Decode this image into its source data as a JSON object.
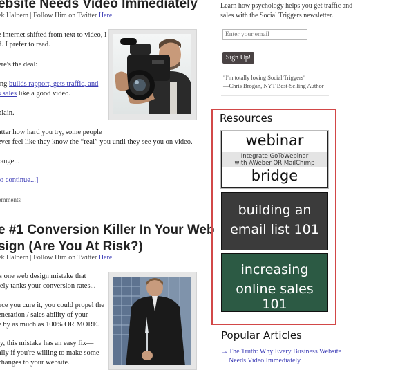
{
  "post1": {
    "title": "ebsite Needs Video Immediately",
    "meta_author": "ek Halpern | Follow Him on Twitter ",
    "meta_link": "Here",
    "p1_l1": "e internet shifted from text to video, I",
    "p1_l2": "d. I prefer to read.",
    "p2": "ere's the deal:",
    "p3_pre": "ing ",
    "p3_link1": "builds rapport, gets traffic, and",
    "p3_link2": "s sales",
    "p3_post": " like a good video.",
    "p4": "plain.",
    "p5_l1": "atter how hard you try, some people",
    "p5_l2": "ever feel like they know the “real” you until they see you on video.",
    "p6": "range...",
    "continue": "to continue...]",
    "comments": "omments"
  },
  "post2": {
    "title_l1": "e #1 Conversion Killer In Your Web",
    "title_l2": "sign (Are You At Risk?)",
    "meta_author": "ek Halpern | Follow Him on Twitter ",
    "meta_link": "Here",
    "p1_l1": "'s one web design mistake that",
    "p1_l2": "tely tanks your conversion rates...",
    "p2_l1": "nce you cure it, you could propel the",
    "p2_l2": "eneration / sales ability of your",
    "p2_l3": "e by as much as 100% OR MORE.",
    "p3_l1": "ly, this mistake has an easy fix—",
    "p3_l2": "ally if you're willing to make some",
    "p3_l3": "changes to your website."
  },
  "sidebar": {
    "intro_l1": "Learn how psychology helps you get traffic and",
    "intro_l2": "sales with the Social Triggers newsletter.",
    "email_placeholder": "Enter your email",
    "signup_label": "Sign Up!",
    "quote": "\"I'm totally loving Social Triggers\"",
    "quote_author": "—Chris Brogan, NYT Best-Selling Author",
    "resources_title": "Resources",
    "banner_webinar_top": "webinar",
    "banner_webinar_mid1": "Integrate GoToWebinar",
    "banner_webinar_mid2": "with AWeber OR MailChimp",
    "banner_webinar_bottom": "bridge",
    "banner_email_l1": "building an",
    "banner_email_l2": "email list 101",
    "banner_sales_l1": "increasing",
    "banner_sales_l2": "online sales 101",
    "popular_title": "Popular Articles",
    "popular_item_l1": "The Truth: Why Every Business Website",
    "popular_item_l2": "Needs Video Immediately",
    "popular_bullet": "→"
  }
}
